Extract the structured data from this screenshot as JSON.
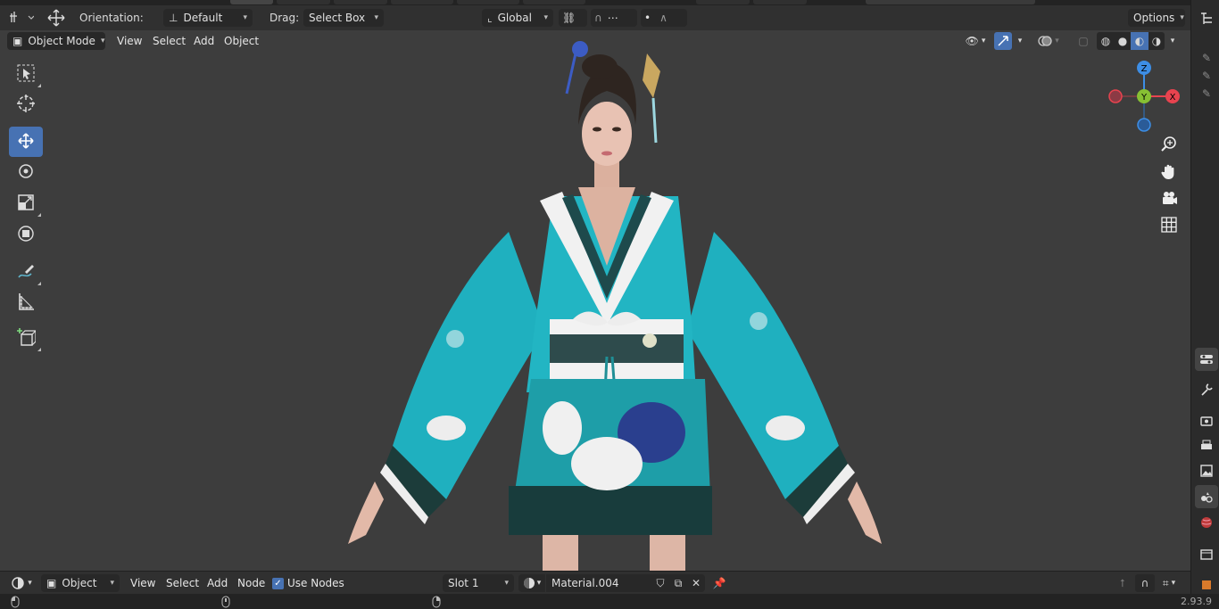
{
  "header": {
    "orientation_label": "Orientation:",
    "orientation_value": "Default",
    "drag_label": "Drag:",
    "drag_value": "Select Box",
    "transform_space": "Global",
    "options_label": "Options"
  },
  "viewport_header": {
    "mode": "Object Mode",
    "menus": [
      "View",
      "Select",
      "Add",
      "Object"
    ]
  },
  "gizmo": {
    "z": "Z",
    "y": "Y",
    "x": "X",
    "colors": {
      "x": "#e8434f",
      "y": "#87c033",
      "z": "#3d8ee6"
    }
  },
  "tools": [
    "select-box-icon",
    "cursor-icon",
    "move-icon",
    "rotate-icon",
    "scale-icon",
    "transform-icon",
    "annotate-icon",
    "measure-icon",
    "add-cube-icon"
  ],
  "node_header": {
    "object_value": "Object",
    "menus": [
      "View",
      "Select",
      "Add",
      "Node"
    ],
    "use_nodes_label": "Use Nodes",
    "use_nodes_checked": true,
    "slot_value": "Slot 1",
    "material_name": "Material.004"
  },
  "status": {
    "version": "2.93.9"
  },
  "colors": {
    "accent": "#4772b3",
    "header": "#303030",
    "viewport": "#3d3d3d"
  }
}
